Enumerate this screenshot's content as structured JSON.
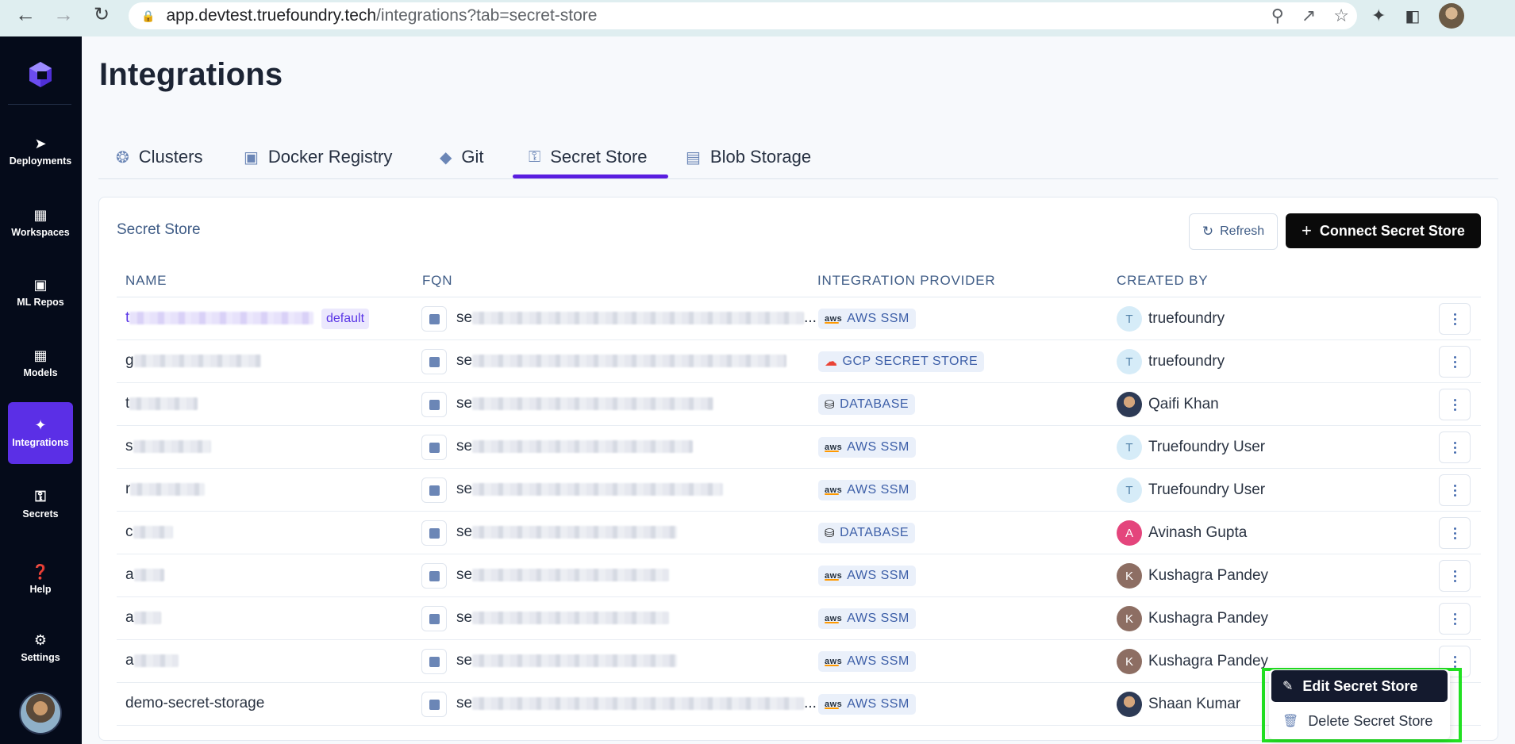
{
  "browser": {
    "url_host": "app.devtest.truefoundry.tech",
    "url_path": "/integrations?tab=secret-store"
  },
  "sidebar": {
    "items": [
      {
        "label": "Deployments",
        "icon": "rocket-icon"
      },
      {
        "label": "Workspaces",
        "icon": "workspace-icon"
      },
      {
        "label": "ML Repos",
        "icon": "folder-icon"
      },
      {
        "label": "Models",
        "icon": "grid-icon"
      },
      {
        "label": "Integrations",
        "icon": "puzzle-icon",
        "active": true
      },
      {
        "label": "Secrets",
        "icon": "key-icon"
      },
      {
        "label": "Help",
        "icon": "help-icon"
      },
      {
        "label": "Settings",
        "icon": "gear-icon"
      }
    ]
  },
  "page": {
    "title": "Integrations",
    "tabs": [
      {
        "label": "Clusters",
        "icon": "kubernetes-icon"
      },
      {
        "label": "Docker Registry",
        "icon": "docker-icon"
      },
      {
        "label": "Git",
        "icon": "git-icon"
      },
      {
        "label": "Secret Store",
        "icon": "key-icon",
        "active": true
      },
      {
        "label": "Blob Storage",
        "icon": "storage-icon"
      }
    ]
  },
  "card": {
    "title": "Secret Store",
    "refresh_label": "Refresh",
    "connect_label": "Connect Secret Store",
    "columns": [
      "NAME",
      "FQN",
      "INTEGRATION PROVIDER",
      "CREATED BY"
    ],
    "default_badge": "default",
    "rows": [
      {
        "name_prefix": "t",
        "fqn_prefix": "se",
        "fqn_suffix": "...",
        "provider": "AWS SSM",
        "provider_icon": "aws",
        "creator": "truefoundry",
        "avatar": "T"
      },
      {
        "name_prefix": "g",
        "fqn_prefix": "se",
        "fqn_suffix": "",
        "provider": "GCP SECRET STORE",
        "provider_icon": "gcp",
        "creator": "truefoundry",
        "avatar": "T"
      },
      {
        "name_prefix": "t",
        "fqn_prefix": "se",
        "fqn_suffix": "",
        "provider": "DATABASE",
        "provider_icon": "database",
        "creator": "Qaifi Khan",
        "avatar": ""
      },
      {
        "name_prefix": "s",
        "fqn_prefix": "se",
        "fqn_suffix": "",
        "provider": "AWS SSM",
        "provider_icon": "aws",
        "creator": "Truefoundry User",
        "avatar": "T"
      },
      {
        "name_prefix": "r",
        "fqn_prefix": "se",
        "fqn_suffix": "",
        "provider": "AWS SSM",
        "provider_icon": "aws",
        "creator": "Truefoundry User",
        "avatar": "T"
      },
      {
        "name_prefix": "c",
        "fqn_prefix": "se",
        "fqn_suffix": "",
        "provider": "DATABASE",
        "provider_icon": "database",
        "creator": "Avinash Gupta",
        "avatar": "A"
      },
      {
        "name_prefix": "a",
        "fqn_prefix": "se",
        "fqn_suffix": "",
        "provider": "AWS SSM",
        "provider_icon": "aws",
        "creator": "Kushagra Pandey",
        "avatar": "K"
      },
      {
        "name_prefix": "a",
        "fqn_prefix": "se",
        "fqn_suffix": "",
        "provider": "AWS SSM",
        "provider_icon": "aws",
        "creator": "Kushagra Pandey",
        "avatar": "K"
      },
      {
        "name_prefix": "a",
        "fqn_prefix": "se",
        "fqn_suffix": "",
        "provider": "AWS SSM",
        "provider_icon": "aws",
        "creator": "Kushagra Pandey",
        "avatar": "K"
      },
      {
        "name_prefix": "demo-secret-storage",
        "fqn_prefix": "se",
        "fqn_suffix": "...",
        "provider": "AWS SSM",
        "provider_icon": "aws",
        "creator": "Shaan Kumar",
        "avatar": ""
      }
    ]
  },
  "row_menu": {
    "items": [
      {
        "label": "Edit Secret Store",
        "icon": "pencil-icon"
      },
      {
        "label": "Delete Secret Store",
        "icon": "trash-icon"
      }
    ]
  }
}
